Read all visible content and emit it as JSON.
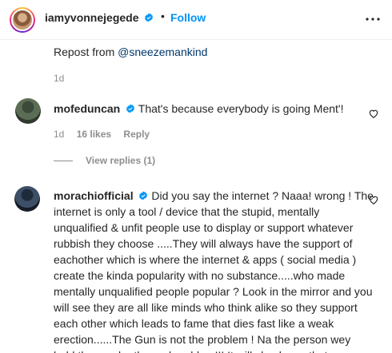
{
  "header": {
    "username": "iamyvonnejegede",
    "separator": "•",
    "follow_label": "Follow"
  },
  "post": {
    "repost_prefix": "Repost from ",
    "repost_mention": "@sneezemankind",
    "time": "1d"
  },
  "comments": [
    {
      "username": "mofeduncan",
      "text": "That's because everybody is going Ment'!",
      "time": "1d",
      "likes": "16 likes",
      "reply_label": "Reply",
      "view_replies": "View replies (1)"
    },
    {
      "username": "morachiofficial",
      "text": "Did you say the internet ? Naaa! wrong ! The internet is only a tool / device that the stupid, mentally unqualified & unfit people use to display or support whatever rubbish they choose .....They will always have the support of eachother which is where the internet & apps ( social media ) create the kinda popularity with no substance.....who made mentally unqualified people popular ? Look in the mirror and you will see they are all like minds who think alike so they support each other which leads to fame that dies fast like a weak erection......The Gun is not the problem ! Na the person wey hold the gun be the real problem!!! It will shock you that"
    }
  ],
  "colors": {
    "accent": "#0095f6",
    "verified": "#0095f6",
    "mention": "#00376b",
    "muted": "#8e8e8e"
  },
  "icons": [
    "verified-badge-icon",
    "more-options-icon",
    "heart-icon"
  ]
}
